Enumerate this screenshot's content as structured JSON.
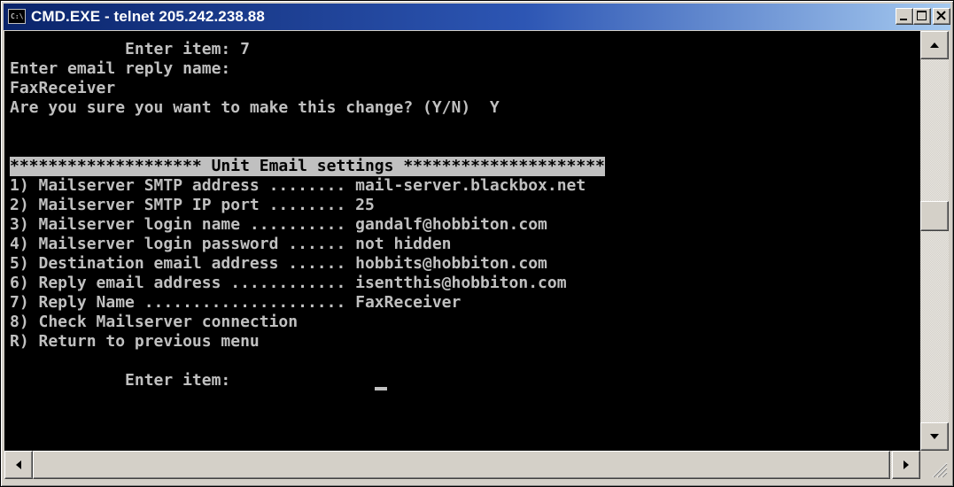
{
  "window": {
    "title": "CMD.EXE - telnet 205.242.238.88",
    "icon": "cmd-icon",
    "icon_text": "C:\\"
  },
  "title_buttons": {
    "minimize_icon": "minimize-icon",
    "maximize_icon": "maximize-icon",
    "close_icon": "close-icon"
  },
  "console": {
    "foreground": "#c0c0c0",
    "background": "#000000",
    "lines": [
      "            Enter item: 7",
      "Enter email reply name:",
      "FaxReceiver",
      "Are you sure you want to make this change? (Y/N)  Y",
      "",
      "",
      "******************** Unit Email settings *********************",
      "1) Mailserver SMTP address ........ mail-server.blackbox.net",
      "2) Mailserver SMTP IP port ........ 25",
      "3) Mailserver login name .......... gandalf@hobbiton.com",
      "4) Mailserver login password ...... not hidden",
      "5) Destination email address ...... hobbits@hobbiton.com",
      "6) Reply email address ............ isentthis@hobbiton.com",
      "7) Reply Name ..................... FaxReceiver",
      "8) Check Mailserver connection",
      "R) Return to previous menu",
      "",
      "            Enter item: "
    ]
  },
  "scrollbars": {
    "up_icon": "arrow-up-icon",
    "down_icon": "arrow-down-icon",
    "left_icon": "arrow-left-icon",
    "right_icon": "arrow-right-icon"
  }
}
